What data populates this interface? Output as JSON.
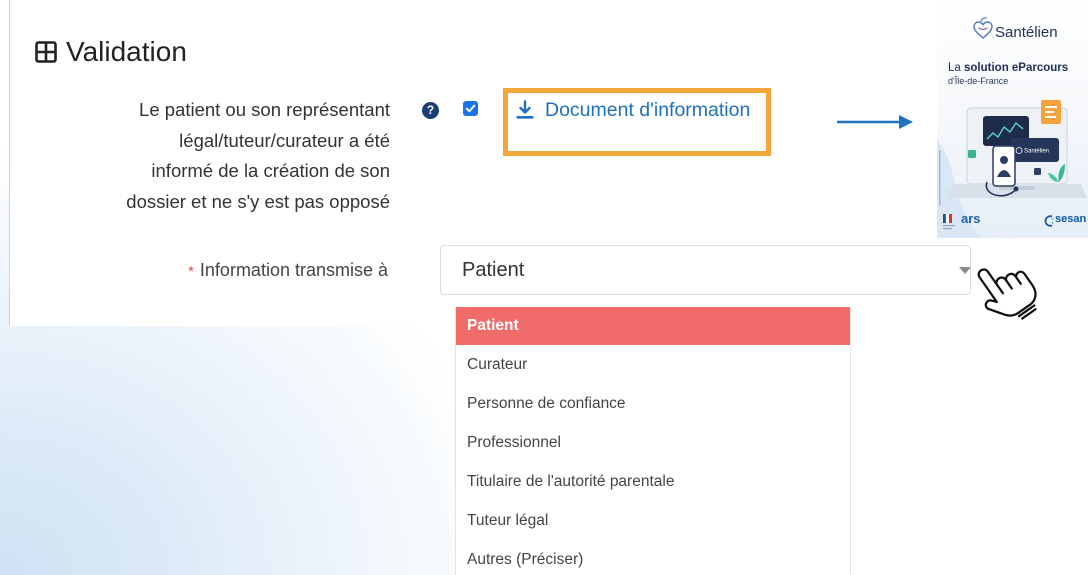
{
  "validation": {
    "title": "Validation",
    "title_icon": "table-icon",
    "consent": {
      "label_lines": [
        "Le patient ou son représentant",
        "légal/tuteur/curateur a été",
        "informé de la création de son",
        "dossier et ne s'y est pas opposé"
      ],
      "help_icon": "question-circle-icon",
      "checked": true,
      "document_link": {
        "icon": "download-icon",
        "label": "Document d'information"
      }
    },
    "transmitted_to": {
      "required_mark": "*",
      "label": "Information transmise à",
      "selected_value": "Patient",
      "caret_icon": "caret-down-icon",
      "dropdown_open": true,
      "highlighted_index": 0,
      "options": [
        "Patient",
        "Curateur",
        "Personne de confiance",
        "Professionnel",
        "Titulaire de l'autorité parentale",
        "Tuteur légal",
        "Autres (Préciser)"
      ]
    }
  },
  "annotations": {
    "arrow_icon": "arrow-right-icon",
    "cursor_icon": "hand-pointer-icon"
  },
  "brochure": {
    "brand": "Santélien",
    "tagline_prefix": "La",
    "tagline_bold": "solution eParcours",
    "region": "d'Île-de-France",
    "screen_logo": "Santélien",
    "footer_logos": [
      "ars",
      "sesan"
    ]
  },
  "colors": {
    "link": "#1F6FBF",
    "highlight_box": "#F3A63A",
    "checkbox": "#1A73E8",
    "help_icon": "#1B3F73",
    "arrow": "#1E73BE",
    "required": "#E5484D",
    "option_active_bg": "#F26B6B",
    "brochure_accent": "#F7A23A"
  }
}
